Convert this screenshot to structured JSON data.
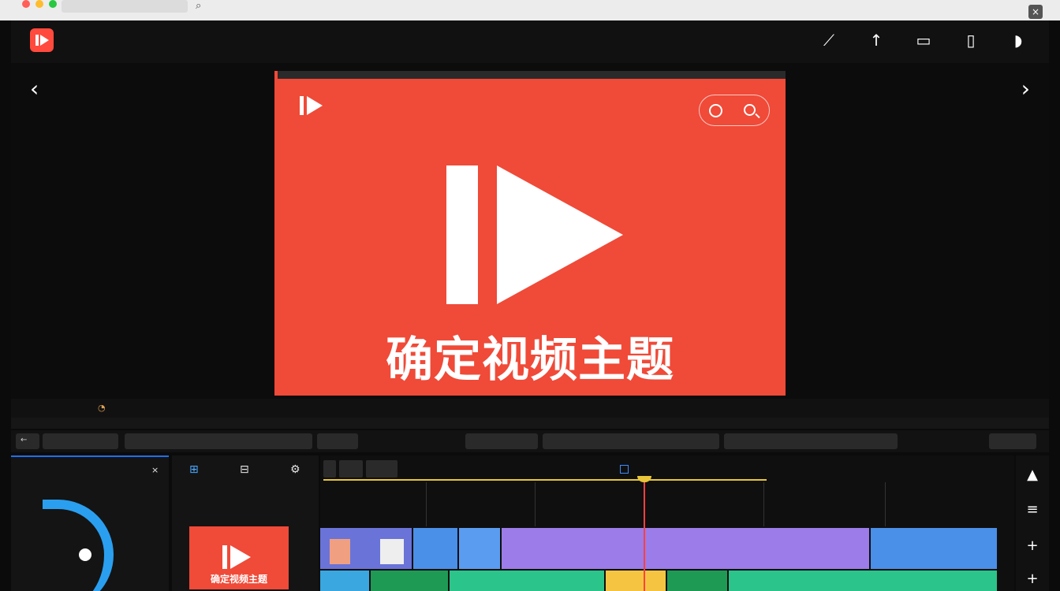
{
  "browser": {
    "url_text": "",
    "window_title": "",
    "right_labels": [
      "",
      "",
      ""
    ]
  },
  "app": {
    "name": "",
    "header_icons": [
      "magic-wand-icon",
      "upload-icon",
      "export-icon",
      "share-icon",
      "notification-icon"
    ]
  },
  "preview": {
    "brand": "",
    "title": "确定视频主题"
  },
  "status_bar": {
    "left_text": "",
    "center_items": [
      "",
      "",
      ""
    ],
    "right_text": "",
    "far_right_text": ""
  },
  "controls": {
    "boxes": [
      "",
      "",
      "",
      "",
      "",
      "",
      ""
    ]
  },
  "left_panel": {
    "tabs": [
      "",
      "",
      "×"
    ],
    "labels": [
      "",
      "",
      ""
    ],
    "items": [
      "",
      "",
      "",
      "",
      "",
      ""
    ]
  },
  "media_panel": {
    "label": "",
    "thumb_caption": "确定视频主题"
  },
  "timeline": {
    "buttons": [
      "",
      "",
      ""
    ],
    "checkbox_label": "",
    "clips_top": [
      "",
      "",
      ""
    ],
    "clips_bottom": [
      "",
      "",
      "",
      ""
    ]
  },
  "colors": {
    "brand_red": "#f04a38",
    "accent_blue": "#2a9ff0",
    "playhead": "#ff4040",
    "ruler_yellow": "#e8c53a"
  }
}
